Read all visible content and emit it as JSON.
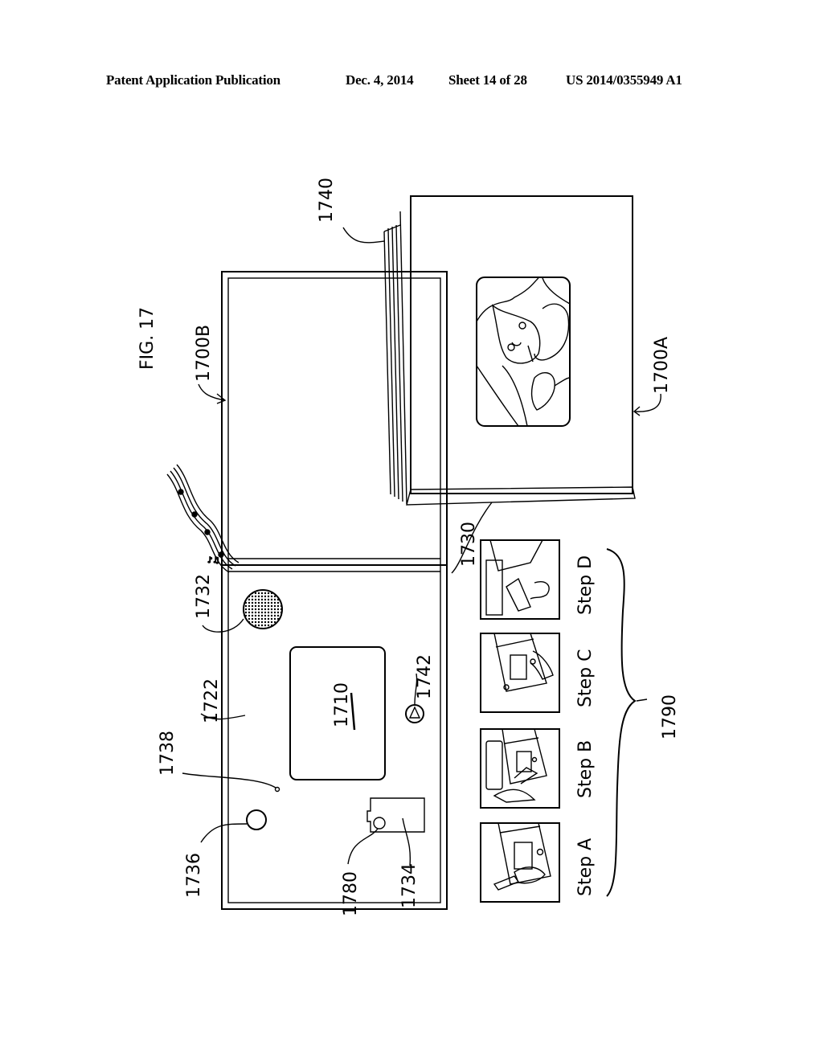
{
  "header": {
    "publication": "Patent Application Publication",
    "date": "Dec. 4, 2014",
    "sheet": "Sheet 14 of 28",
    "pub_number": "US 2014/0355949 A1"
  },
  "figure": {
    "title": "FIG. 17",
    "labels": {
      "l1700A": "1700A",
      "l1700B": "1700B",
      "l1710": "1710",
      "l1722": "1722",
      "l1730": "1730",
      "l1732": "1732",
      "l1734": "1734",
      "l1736": "1736",
      "l1738": "1738",
      "l1740": "1740",
      "l1742": "1742",
      "l1780": "1780",
      "l1790": "1790"
    },
    "steps": [
      "Step A",
      "Step B",
      "Step C",
      "Step D"
    ],
    "icons": {
      "speaker": "speaker-grille-icon",
      "music": "music-notes-icon",
      "play_button": "triangle-button-icon"
    }
  }
}
